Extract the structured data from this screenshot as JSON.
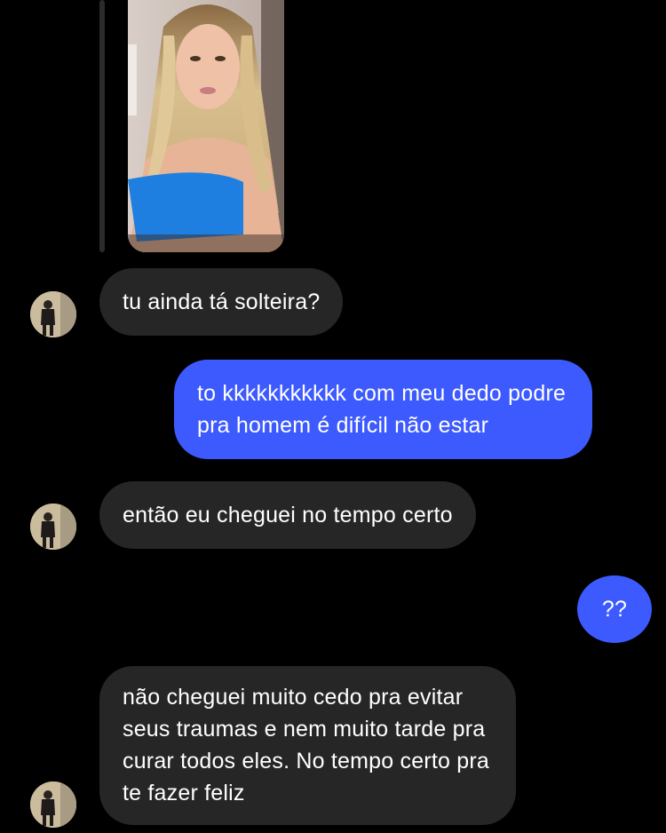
{
  "colors": {
    "background": "#000000",
    "incoming_bubble": "#262626",
    "outgoing_bubble": "#3d5afe",
    "text": "#ffffff"
  },
  "shared_photo": {
    "icon": "photo-of-woman-in-blue-top"
  },
  "messages": [
    {
      "sender": "them",
      "text": "tu ainda tá solteira?"
    },
    {
      "sender": "me",
      "text": "to kkkkkkkkkkk com meu dedo podre\npra homem é difícil não estar"
    },
    {
      "sender": "them",
      "text": "então eu cheguei no tempo certo"
    },
    {
      "sender": "me",
      "text": "??"
    },
    {
      "sender": "them",
      "text": "não cheguei muito cedo pra evitar\nseus traumas e nem muito tarde pra\ncurar todos eles. No tempo certo pra\nte fazer feliz"
    }
  ]
}
